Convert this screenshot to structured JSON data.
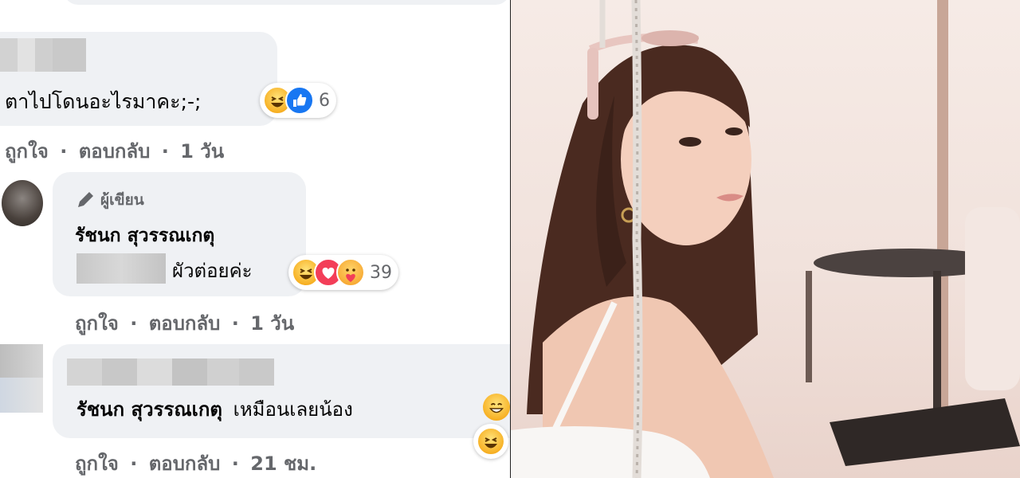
{
  "comments": [
    {
      "text": "ตาไปโดนอะไรมาคะ;-;",
      "reaction_count": "6",
      "actions": {
        "like": "ถูกใจ",
        "reply": "ตอบกลับ",
        "time": "1 วัน",
        "sep": "·"
      }
    },
    {
      "badge": "ผู้เขียน",
      "author": "รัชนก สุวรรณเกตุ",
      "text": "ผัวต่อยค่ะ",
      "reaction_count": "39",
      "actions": {
        "like": "ถูกใจ",
        "reply": "ตอบกลับ",
        "time": "1 วัน",
        "sep": "·"
      }
    },
    {
      "mention": "รัชนก สุวรรณเกตุ",
      "text": "เหมือนเลยน้อง",
      "actions": {
        "like": "ถูกใจ",
        "reply": "ตอบกลับ",
        "time": "21 ชม.",
        "sep": "·"
      }
    }
  ],
  "colors": {
    "bubble": "#eff1f4",
    "secondary_text": "#65676b",
    "haha": "#f7b125",
    "like": "#1877f2",
    "love": "#f33e58"
  },
  "icons": [
    "haha-reaction-icon",
    "like-reaction-icon",
    "love-reaction-icon",
    "care-reaction-icon",
    "pencil-icon"
  ]
}
